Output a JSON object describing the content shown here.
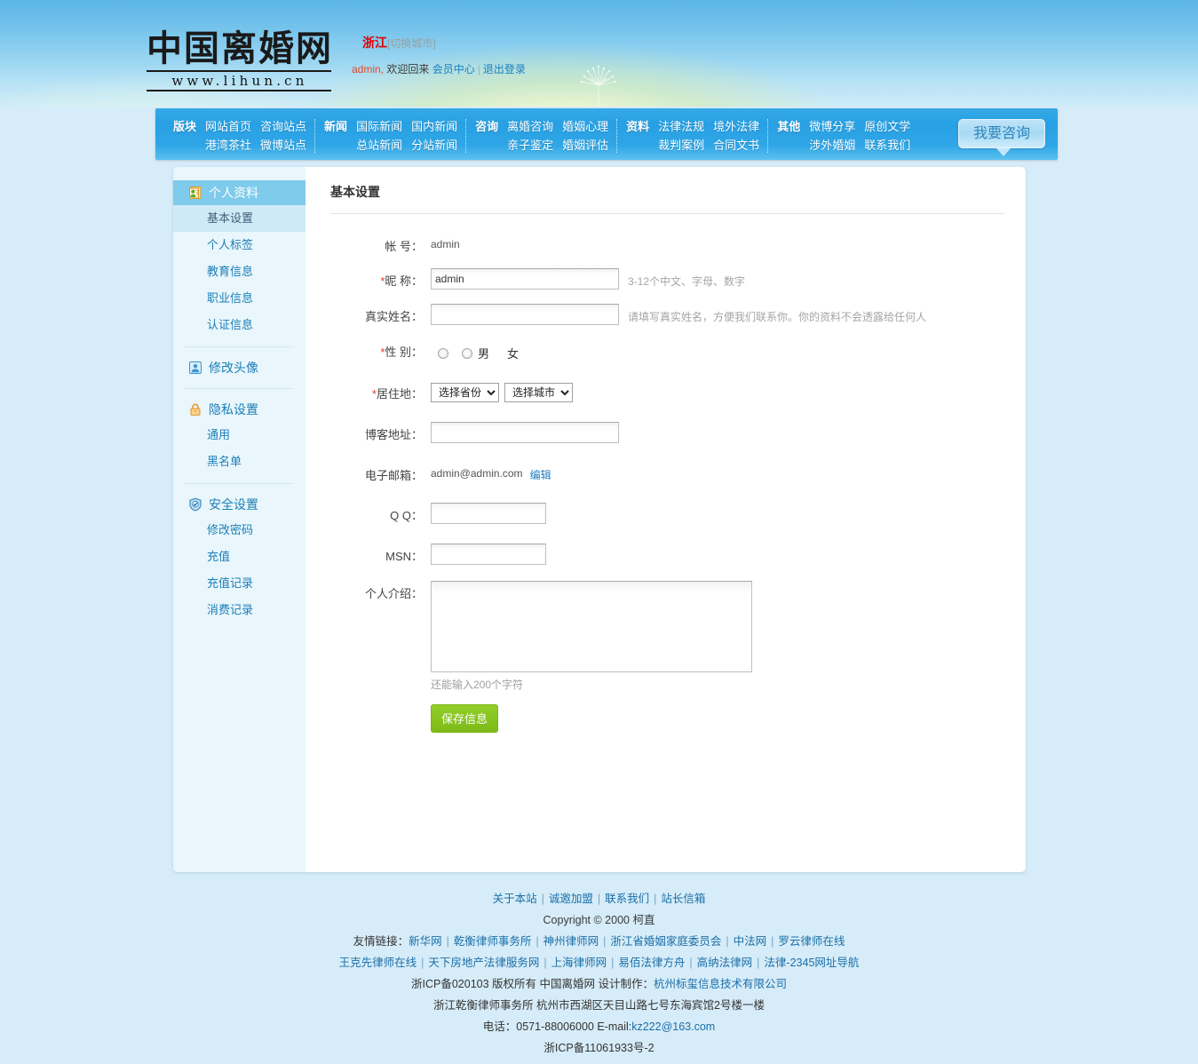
{
  "header": {
    "logo_text": "中国离婚网",
    "logo_url": "www.lihun.cn",
    "city_name": "浙江",
    "city_switch": "[切换城市]",
    "username": "admin,",
    "welcome": "欢迎回来",
    "member_center": "会员中心",
    "logout": "退出登录",
    "separator": "|"
  },
  "nav": {
    "consult_button": "我要咨询",
    "groups": [
      {
        "category": "版块",
        "links": [
          "网站首页",
          "咨询站点",
          "港湾茶社",
          "微博站点"
        ]
      },
      {
        "category": "新闻",
        "links": [
          "国际新闻",
          "国内新闻",
          "总站新闻",
          "分站新闻"
        ]
      },
      {
        "category": "咨询",
        "links": [
          "离婚咨询",
          "婚姻心理",
          "亲子鉴定",
          "婚姻评估"
        ]
      },
      {
        "category": "资料",
        "links": [
          "法律法规",
          "境外法律",
          "裁判案例",
          "合同文书"
        ]
      },
      {
        "category": "其他",
        "links": [
          "微博分享",
          "原创文学",
          "涉外婚姻",
          "联系我们"
        ]
      }
    ]
  },
  "sidebar": {
    "sections": [
      {
        "title": "个人资料",
        "icon": "profile-card-icon",
        "active": true,
        "items": [
          {
            "label": "基本设置",
            "current": true
          },
          {
            "label": "个人标签",
            "current": false
          },
          {
            "label": "教育信息",
            "current": false
          },
          {
            "label": "职业信息",
            "current": false
          },
          {
            "label": "认证信息",
            "current": false
          }
        ]
      },
      {
        "title": "修改头像",
        "icon": "avatar-icon",
        "active": false,
        "items": []
      },
      {
        "title": "隐私设置",
        "icon": "lock-icon",
        "active": false,
        "items": [
          {
            "label": "通用",
            "current": false
          },
          {
            "label": "黑名单",
            "current": false
          }
        ]
      },
      {
        "title": "安全设置",
        "icon": "shield-check-icon",
        "active": false,
        "items": [
          {
            "label": "修改密码",
            "current": false
          },
          {
            "label": "充值",
            "current": false
          },
          {
            "label": "充值记录",
            "current": false
          },
          {
            "label": "消费记录",
            "current": false
          }
        ]
      }
    ]
  },
  "form": {
    "page_title": "基本设置",
    "account_label": "帐 号：",
    "account_value": "admin",
    "nickname_label": "昵 称：",
    "nickname_value": "admin",
    "nickname_hint": "3-12个中文、字母、数字",
    "realname_label": "真实姓名：",
    "realname_value": "",
    "realname_hint": "请填写真实姓名，方便我们联系你。你的资料不会透露给任何人",
    "gender_label": "性 别：",
    "gender_male": "男",
    "gender_female": "女",
    "residence_label": "居住地：",
    "province_selected": "选择省份",
    "city_selected": "选择城市",
    "blog_label": "博客地址：",
    "blog_value": "",
    "email_label": "电子邮箱：",
    "email_value": "admin@admin.com",
    "email_edit": "编辑",
    "qq_label": "Q Q：",
    "qq_value": "",
    "msn_label": "MSN：",
    "msn_value": "",
    "intro_label": "个人介绍：",
    "intro_value": "",
    "intro_counter": "还能输入200个字符",
    "save_label": "保存信息",
    "required_mark": "*"
  },
  "footer": {
    "top_links": [
      "关于本站",
      "诚邀加盟",
      "联系我们",
      "站长信箱"
    ],
    "copyright": "Copyright © 2000 柯直",
    "friend_label": "友情链接：",
    "friend_links_row1": [
      "新华网",
      "乾衡律师事务所",
      "神州律师网",
      "浙江省婚姻家庭委员会",
      "中法网",
      "罗云律师在线"
    ],
    "friend_links_row2": [
      "王克先律师在线",
      "天下房地产法律服务网",
      "上海律师网",
      "易佰法律方舟",
      "高纳法律网",
      "法律-2345网址导航"
    ],
    "icp_line_prefix": "浙ICP备020103 版权所有 中国离婚网 设计制作：",
    "icp_line_link": "杭州标玺信息技术有限公司",
    "address_line": "浙江乾衡律师事务所 杭州市西湖区天目山路七号东海宾馆2号楼一楼",
    "phone_prefix": "电话：0571-88006000 E-mail:",
    "phone_email": "kz222@163.com",
    "icp_bottom": "浙ICP备11061933号-2"
  },
  "colors": {
    "nav_blue": "#27a0e3",
    "sidebar_bg": "#e9f6fb",
    "active_blue": "#7ecbeb",
    "page_bg": "#d6ecf8",
    "save_green": "#86c31f",
    "link_blue": "#1b7fc4",
    "required_red": "#e33b28"
  }
}
